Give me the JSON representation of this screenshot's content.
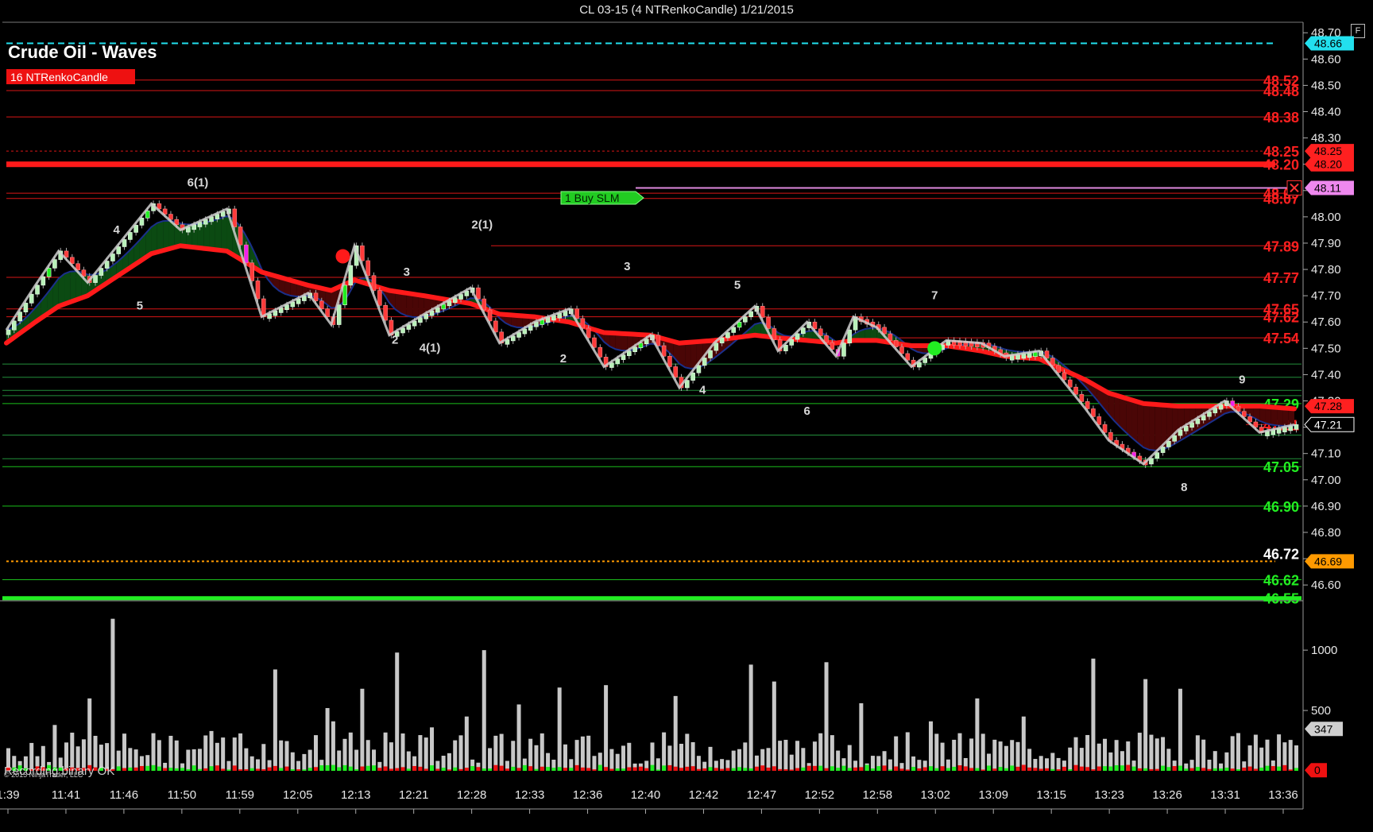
{
  "window_title": "CL 03-15 (4 NTRenkoCandle)  1/21/2015",
  "f_button": "F",
  "chart_title": "Crude Oil - Waves",
  "tag": "16 NTRenkoCandle",
  "order_label": "1  Buy SLM",
  "footer_status": "Recording binary OK",
  "footer_copyright": "© 2015 NinjaTrader, LLC",
  "colors": {
    "up": "#b8f0b8",
    "down": "#ff3b3b",
    "ma": "#ff1a1a",
    "cyan": "#22e0ee",
    "orange": "#ff9a00",
    "green": "#22ee22"
  },
  "chart_data": [
    {
      "type": "line",
      "title": "Crude Oil - Waves",
      "x_ticks": [
        "1:39",
        "11:41",
        "11:46",
        "11:50",
        "11:59",
        "12:05",
        "12:13",
        "12:21",
        "12:28",
        "12:33",
        "12:36",
        "12:40",
        "12:42",
        "12:47",
        "12:52",
        "12:58",
        "13:02",
        "13:09",
        "13:15",
        "13:23",
        "13:26",
        "13:31",
        "13:36"
      ],
      "y_ticks": [
        46.6,
        46.7,
        46.8,
        46.9,
        47.0,
        47.1,
        47.2,
        47.3,
        47.4,
        47.5,
        47.6,
        47.7,
        47.8,
        47.9,
        48.0,
        48.1,
        48.2,
        48.3,
        48.4,
        48.5,
        48.6,
        48.7
      ],
      "ylim": [
        46.54,
        48.74
      ],
      "price_path_x": [
        0,
        5,
        9,
        14,
        25,
        30,
        38,
        44,
        52,
        56,
        60,
        66,
        72,
        80,
        85,
        91,
        97,
        103,
        111,
        116,
        122,
        129,
        133,
        138,
        143,
        146,
        150,
        156,
        162,
        168,
        172,
        178,
        186,
        190,
        196,
        202,
        210,
        216,
        222
      ],
      "price_path": [
        47.57,
        47.74,
        47.87,
        47.75,
        48.05,
        47.95,
        48.03,
        47.62,
        47.71,
        47.59,
        47.89,
        47.55,
        47.63,
        47.73,
        47.52,
        47.6,
        47.65,
        47.43,
        47.55,
        47.35,
        47.52,
        47.66,
        47.49,
        47.6,
        47.47,
        47.62,
        47.58,
        47.43,
        47.53,
        47.52,
        47.47,
        47.49,
        47.27,
        47.15,
        47.06,
        47.19,
        47.3,
        47.18,
        47.21
      ],
      "moving_average": [
        47.52,
        47.6,
        47.66,
        47.7,
        47.86,
        47.89,
        47.87,
        47.79,
        47.74,
        47.72,
        47.76,
        47.72,
        47.7,
        47.67,
        47.63,
        47.62,
        47.6,
        47.56,
        47.55,
        47.52,
        47.53,
        47.55,
        47.54,
        47.53,
        47.52,
        47.53,
        47.53,
        47.51,
        47.51,
        47.49,
        47.47,
        47.46,
        47.38,
        47.33,
        47.29,
        47.28,
        47.28,
        47.28,
        47.27
      ],
      "pivots": [
        {
          "label": "4",
          "x": 19,
          "y": 47.87,
          "pos": "top"
        },
        {
          "label": "5",
          "x": 23,
          "y": 47.75,
          "pos": "bottom"
        },
        {
          "label": "6(1)",
          "x": 33,
          "y": 48.05,
          "pos": "top"
        },
        {
          "label": "2",
          "x": 67,
          "y": 47.62,
          "pos": "bottom"
        },
        {
          "label": "3",
          "x": 69,
          "y": 47.71,
          "pos": "top"
        },
        {
          "label": "4(1)",
          "x": 73,
          "y": 47.59,
          "pos": "bottom"
        },
        {
          "label": "2(1)",
          "x": 82,
          "y": 47.89,
          "pos": "top"
        },
        {
          "label": "2",
          "x": 96,
          "y": 47.55,
          "pos": "bottom"
        },
        {
          "label": "3",
          "x": 107,
          "y": 47.73,
          "pos": "top"
        },
        {
          "label": "4",
          "x": 120,
          "y": 47.43,
          "pos": "bottom"
        },
        {
          "label": "5",
          "x": 126,
          "y": 47.66,
          "pos": "top"
        },
        {
          "label": "6",
          "x": 138,
          "y": 47.35,
          "pos": "bottom"
        },
        {
          "label": "7",
          "x": 160,
          "y": 47.62,
          "pos": "top"
        },
        {
          "label": "8",
          "x": 203,
          "y": 47.06,
          "pos": "bottom"
        },
        {
          "label": "9",
          "x": 213,
          "y": 47.3,
          "pos": "top"
        }
      ],
      "levels_red": [
        48.52,
        48.48,
        48.38,
        48.25,
        48.2,
        48.09,
        48.07,
        47.89,
        47.77,
        47.65,
        47.62,
        47.54,
        47.21
      ],
      "levels_green": [
        47.29,
        47.05,
        46.9,
        46.62,
        46.55
      ],
      "level_white": 46.72,
      "price_tags": [
        {
          "value": 48.66,
          "text": "48.66",
          "color": "#22e0ee"
        },
        {
          "value": 48.25,
          "text": "48.25",
          "color": "#ff2020"
        },
        {
          "value": 48.2,
          "text": "48.20",
          "color": "#ff2020"
        },
        {
          "value": 48.11,
          "text": "48.11",
          "color": "#ee88ee"
        },
        {
          "value": 47.28,
          "text": "47.28",
          "color": "#ff2020"
        },
        {
          "value": 47.21,
          "text": "47.21",
          "color": "#000000"
        },
        {
          "value": 46.69,
          "text": "46.69",
          "color": "#ff9a00"
        }
      ],
      "markers": [
        {
          "x": 58,
          "y": 47.85,
          "color": "#ff1a1a"
        },
        {
          "x": 160,
          "y": 47.5,
          "color": "#22ee22"
        }
      ]
    },
    {
      "type": "bar",
      "title": "Volume",
      "y_ticks": [
        500,
        1000
      ],
      "ylim": [
        0,
        1350
      ],
      "last_value": 347,
      "last_delta": 0,
      "volume_spikes": [
        120,
        380,
        600,
        1260,
        290,
        330,
        310,
        840,
        520,
        410,
        680,
        980,
        360,
        450,
        1000,
        550,
        690,
        710,
        620,
        880,
        740,
        900,
        560,
        410,
        600,
        450,
        930,
        760,
        680
      ],
      "volume_spike_x": [
        3,
        8,
        14,
        18,
        28,
        35,
        40,
        46,
        55,
        56,
        61,
        67,
        73,
        79,
        82,
        88,
        95,
        103,
        115,
        128,
        132,
        141,
        147,
        159,
        167,
        175,
        187,
        196,
        202
      ]
    }
  ]
}
